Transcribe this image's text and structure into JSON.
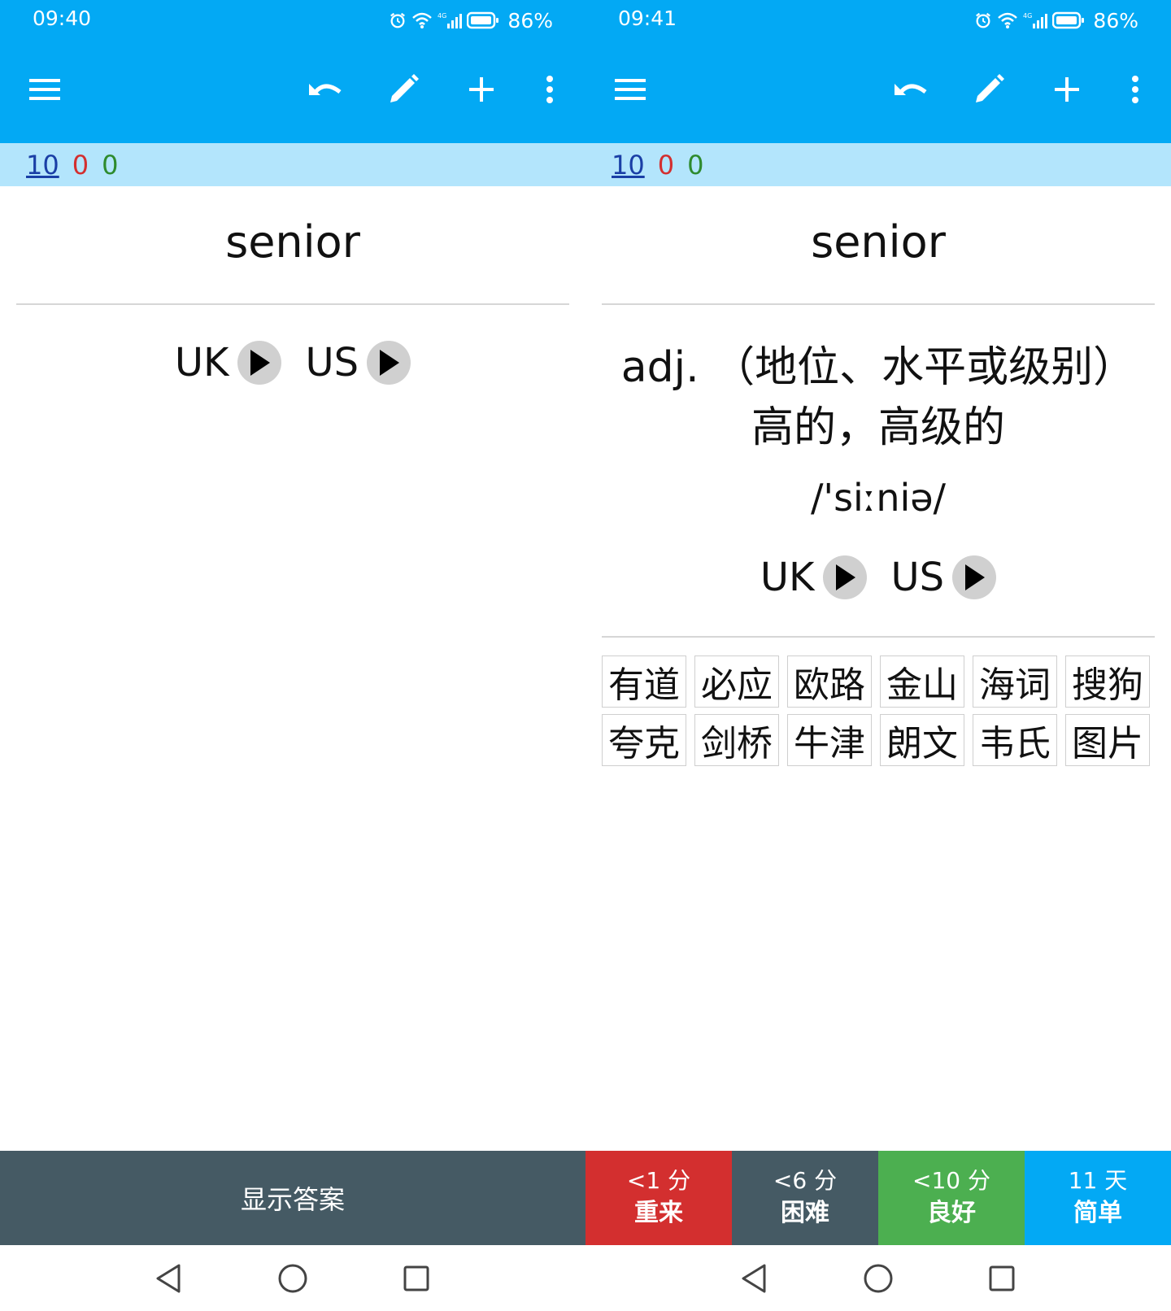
{
  "screens": [
    {
      "status": {
        "time": "09:40",
        "battery": "86%"
      },
      "counts": {
        "new": "10",
        "learning": "0",
        "review": "0"
      },
      "card": {
        "word": "senior",
        "uk_label": "UK",
        "us_label": "US"
      },
      "answer_button": "显示答案"
    },
    {
      "status": {
        "time": "09:41",
        "battery": "86%"
      },
      "counts": {
        "new": "10",
        "learning": "0",
        "review": "0"
      },
      "card": {
        "word": "senior",
        "meaning_line1": "adj. （地位、水平或级别）",
        "meaning_line2": "高的，高级的",
        "phonetic": "/'siːniə/",
        "uk_label": "UK",
        "us_label": "US"
      },
      "dictionaries": [
        "有道",
        "必应",
        "欧路",
        "金山",
        "海词",
        "搜狗",
        "夸克",
        "剑桥",
        "牛津",
        "朗文",
        "韦氏",
        "图片"
      ],
      "ease_buttons": [
        {
          "interval": "<1 分",
          "label": "重来",
          "color": "#d32f2f"
        },
        {
          "interval": "<6 分",
          "label": "困难",
          "color": "#455a64"
        },
        {
          "interval": "<10 分",
          "label": "良好",
          "color": "#4caf50"
        },
        {
          "interval": "11 天",
          "label": "简单",
          "color": "#03a9f4"
        }
      ]
    }
  ],
  "colors": {
    "appbar": "#03a9f4",
    "counts_bar": "#b3e5fc",
    "new_count": "#1a3fa6",
    "learning_count": "#d32f2f",
    "review_count": "#2e8b2e",
    "answer_button": "#455a64"
  },
  "icons": {
    "toolbar": [
      "menu-icon",
      "undo-icon",
      "edit-icon",
      "add-icon",
      "more-vert-icon"
    ],
    "status": [
      "alarm-icon",
      "wifi-icon",
      "signal-4g-icon",
      "battery-icon"
    ],
    "nav": [
      "back-icon",
      "home-icon",
      "recent-apps-icon"
    ]
  }
}
